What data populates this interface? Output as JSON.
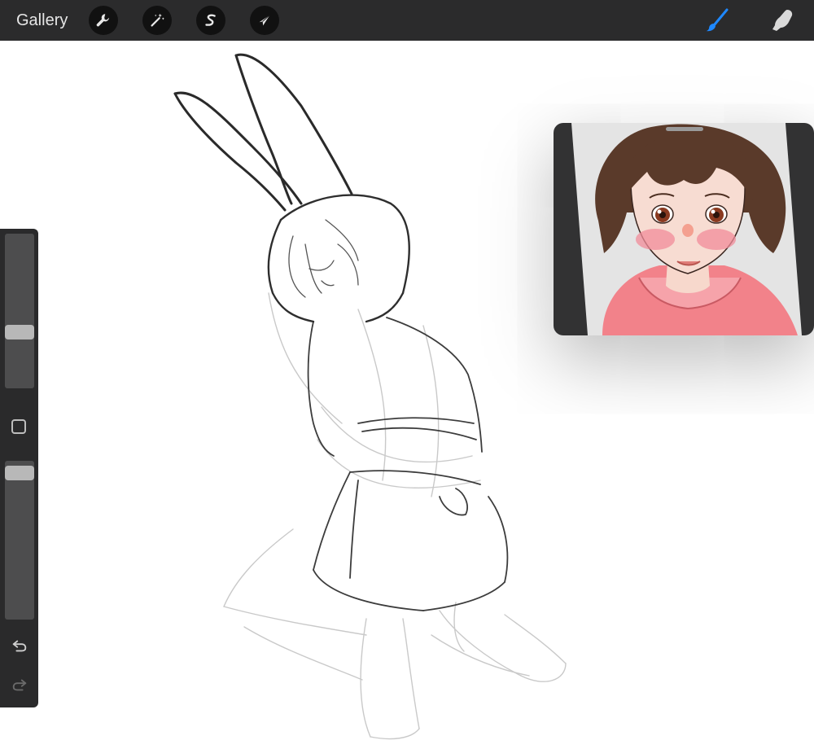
{
  "topbar": {
    "gallery_label": "Gallery",
    "left_tools": [
      "actions",
      "adjustments",
      "selection",
      "transform"
    ],
    "right_tools": [
      "brush",
      "smudge"
    ],
    "active_tool": "brush",
    "active_color": "#1e88ff"
  },
  "sidebar": {
    "brush_size": 0.38,
    "brush_opacity": 0.95,
    "buttons": [
      "modify",
      "undo",
      "redo"
    ]
  },
  "reference_window": {
    "visible": true
  },
  "colors": {
    "toolbar_bg": "#2b2b2c",
    "canvas_bg": "#ffffff",
    "hair": "#5a3a2a",
    "hoodie": "#f2828a"
  }
}
